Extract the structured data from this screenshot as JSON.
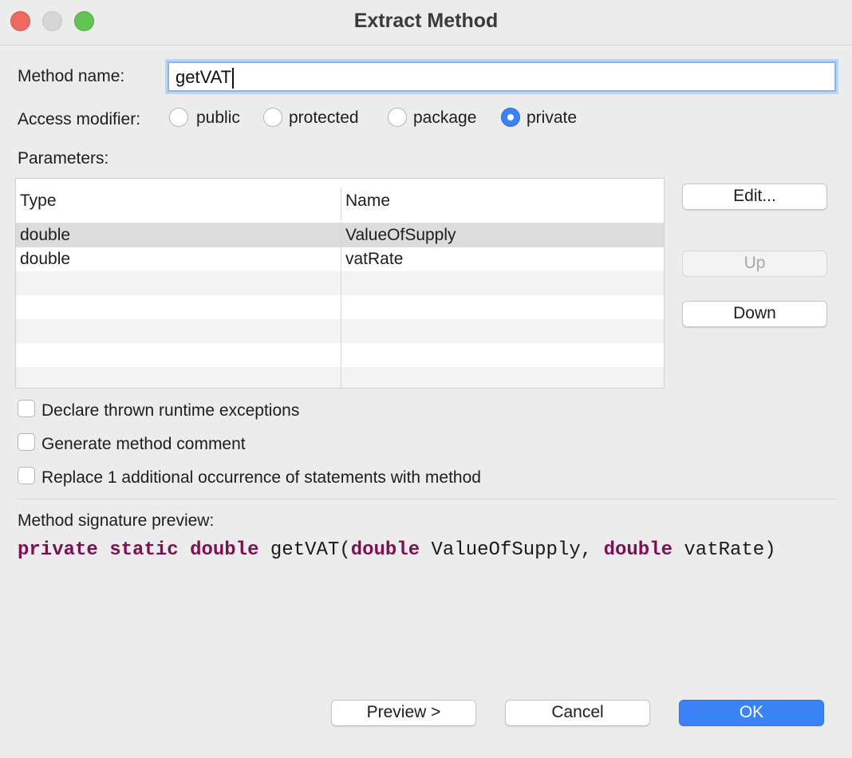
{
  "window": {
    "title": "Extract Method"
  },
  "method_name": {
    "label": "Method name:",
    "value": "getVAT"
  },
  "access": {
    "label": "Access modifier:",
    "options": [
      "public",
      "protected",
      "package",
      "private"
    ],
    "selected": "private"
  },
  "parameters": {
    "label": "Parameters:",
    "columns": [
      "Type",
      "Name"
    ],
    "rows": [
      {
        "type": "double",
        "name": "ValueOfSupply"
      },
      {
        "type": "double",
        "name": "vatRate"
      }
    ],
    "buttons": {
      "edit": "Edit...",
      "up": "Up",
      "down": "Down"
    }
  },
  "options": {
    "declare_exceptions": "Declare thrown runtime exceptions",
    "generate_comment": "Generate method comment",
    "replace_occurrences": "Replace 1 additional occurrence of statements with method"
  },
  "preview": {
    "label": "Method signature preview:",
    "tokens": [
      {
        "text": "private",
        "kw": true
      },
      {
        "text": " ",
        "kw": false
      },
      {
        "text": "static",
        "kw": true
      },
      {
        "text": " ",
        "kw": false
      },
      {
        "text": "double",
        "kw": true
      },
      {
        "text": " getVAT(",
        "kw": false
      },
      {
        "text": "double",
        "kw": true
      },
      {
        "text": " ValueOfSupply, ",
        "kw": false
      },
      {
        "text": "double",
        "kw": true
      },
      {
        "text": " vatRate)",
        "kw": false
      }
    ]
  },
  "footer": {
    "preview": "Preview >",
    "cancel": "Cancel",
    "ok": "OK"
  },
  "colors": {
    "accent": "#3b82f6",
    "keyword": "#7b1152"
  }
}
